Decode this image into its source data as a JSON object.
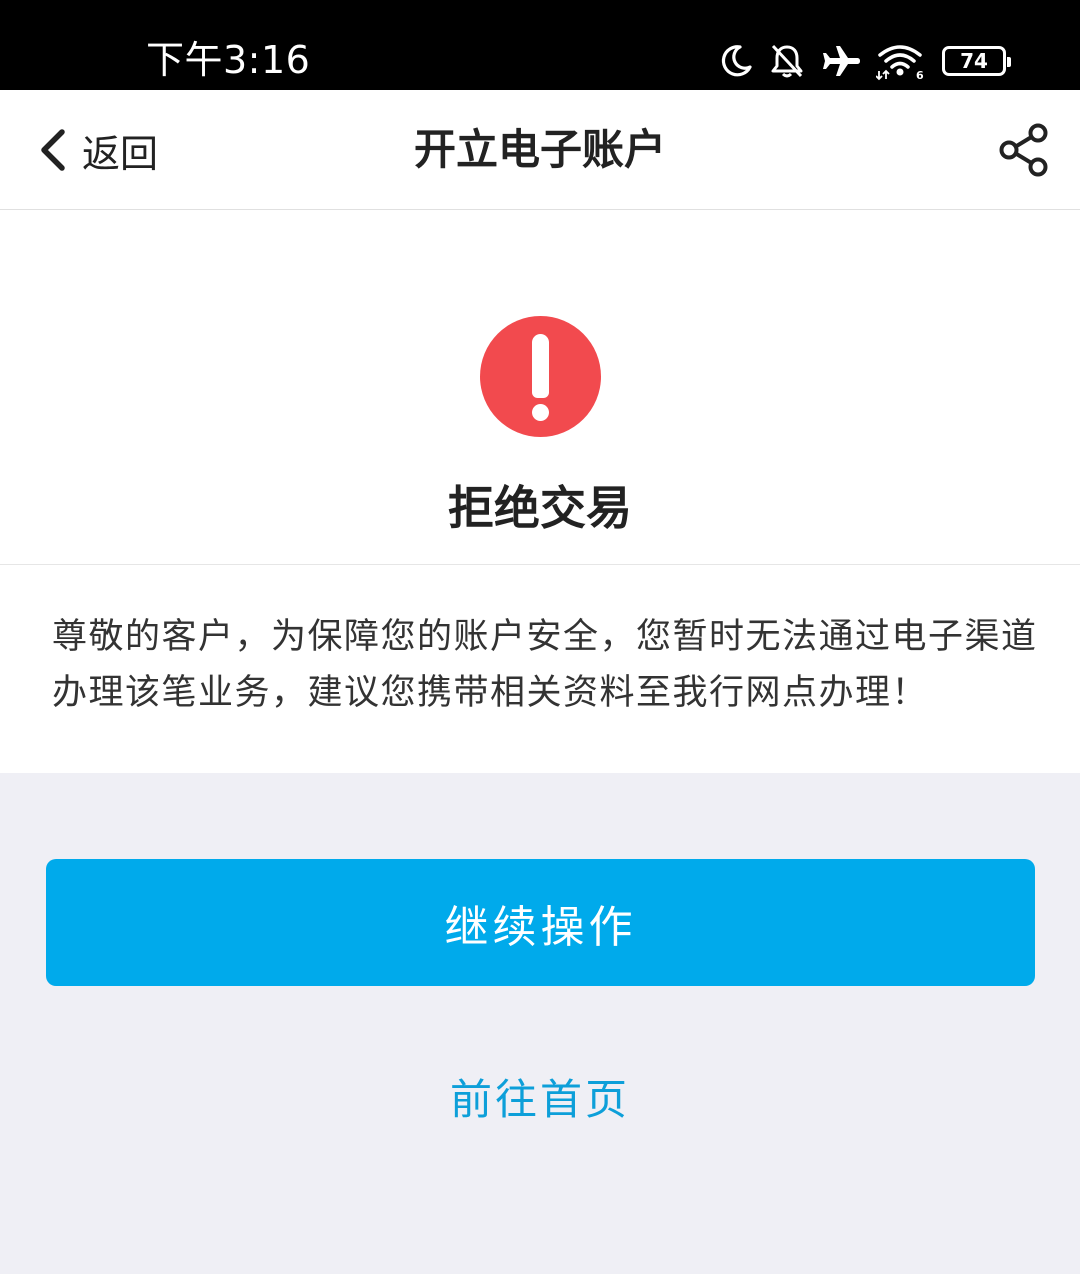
{
  "status_bar": {
    "time": "下午3:16",
    "battery": "74",
    "icons": [
      "moon-icon",
      "bell-muted-icon",
      "airplane-icon",
      "wifi-icon",
      "battery-icon"
    ]
  },
  "nav": {
    "back_label": "返回",
    "title": "开立电子账户",
    "icons": [
      "chevron-left-icon",
      "share-icon"
    ]
  },
  "result": {
    "icon": "alert-icon",
    "icon_color": "#f24a4e",
    "title": "拒绝交易"
  },
  "message": {
    "text": "尊敬的客户，为保障您的账户安全，您暂时无法通过电子渠道办理该笔业务，建议您携带相关资料至我行网点办理！"
  },
  "actions": {
    "continue_label": "继续操作",
    "continue_color": "#00aaeb",
    "home_label": "前往首页",
    "home_color": "#0d9fd9"
  }
}
